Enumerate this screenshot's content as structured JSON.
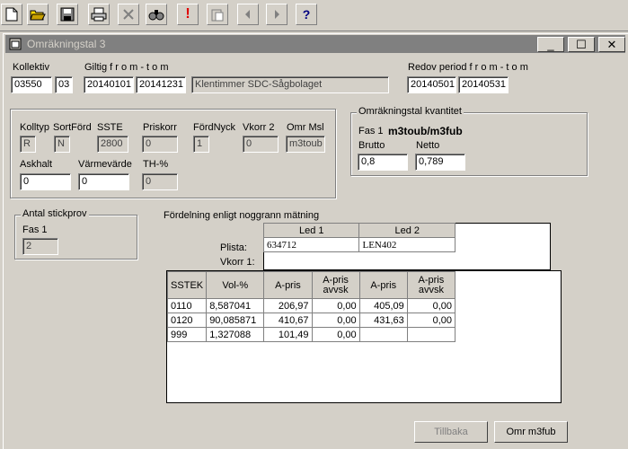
{
  "toolbar": {
    "icons": [
      "new-icon",
      "open-icon",
      "save-icon",
      "print-icon",
      "delete-icon",
      "search-icon",
      "exclamation-icon",
      "paste-icon",
      "prev-icon",
      "next-icon",
      "help-icon"
    ]
  },
  "window": {
    "title": "Omräkningstal 3",
    "min": "_",
    "max": "☐",
    "close": "✕"
  },
  "header": {
    "kollektiv_label": "Kollektiv",
    "kollektiv_value": "03550",
    "kollektiv_sub": "03",
    "giltig_label": "Giltig f r o m - t o m",
    "giltig_from": "20140101",
    "giltig_tom": "20141231",
    "description": "Klentimmer SDC-Sågbolaget",
    "redovperiod_label": "Redov period  f r o m - t o m",
    "redov_from": "20140501",
    "redov_tom": "20140531"
  },
  "params": {
    "kolltyp_label": "Kolltyp",
    "kolltyp_value": "R",
    "sortford_label": "SortFörd",
    "sortford_value": "N",
    "sste_label": "SSTE",
    "sste_value": "2800",
    "priskorr_label": "Priskorr",
    "priskorr_value": "0",
    "fordnyck_label": "FördNyck",
    "fordnyck_value": "1",
    "vkorr2_label": "Vkorr 2",
    "vkorr2_value": "0",
    "omrmsl_label": "Omr Msl",
    "omrmsl_value": "m3toub",
    "askhalt_label": "Askhalt",
    "askhalt_value": "0",
    "varmevarde_label": "Värmevärde",
    "varmevarde_value": "0",
    "th_label": "TH-%",
    "th_value": "0"
  },
  "kvantitet": {
    "legend": "Omräkningstal kvantitet",
    "fas_label": "Fas 1",
    "unit": "m3toub/m3fub",
    "brutto_label": "Brutto",
    "brutto_value": "0,8",
    "netto_label": "Netto",
    "netto_value": "0,789"
  },
  "stickprov": {
    "legend": "Antal stickprov",
    "fas_label": "Fas 1",
    "value": "2"
  },
  "fordelning": {
    "title": "Fördelning enligt noggrann mätning",
    "led1": "Led 1",
    "led2": "Led 2",
    "plista_label": "Plista:",
    "vkorr1_label": "Vkorr 1:",
    "plista_led1": "634712",
    "plista_led2": "LEN402",
    "columns": [
      "SSTEK",
      "Vol-%",
      "A-pris",
      "A-pris avvsk",
      "A-pris",
      "A-pris avvsk"
    ],
    "rows": [
      [
        "0110",
        "8,587041",
        "206,97",
        "0,00",
        "405,09",
        "0,00"
      ],
      [
        "0120",
        "90,085871",
        "410,67",
        "0,00",
        "431,63",
        "0,00"
      ],
      [
        "999",
        "1,327088",
        "101,49",
        "0,00",
        "",
        ""
      ]
    ]
  },
  "buttons": {
    "tillbaka": "Tillbaka",
    "omr": "Omr m3fub"
  }
}
